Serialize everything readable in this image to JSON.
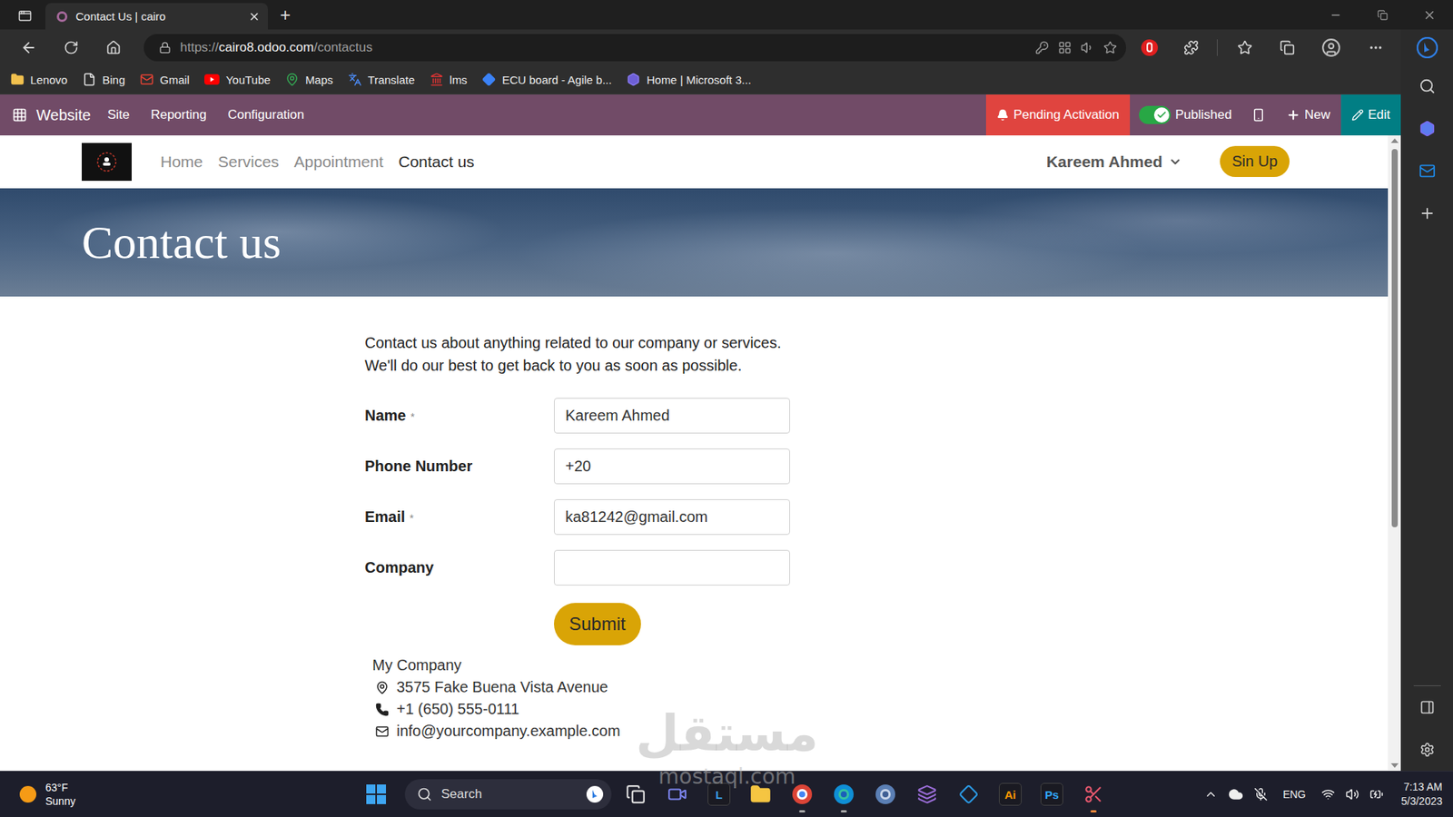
{
  "browser": {
    "tabs": [
      {
        "label": "Contact Us | cairo",
        "selected": true
      }
    ],
    "new_tab": "+",
    "address": {
      "scheme": "https://",
      "host": "cairo8.odoo.com",
      "path": "/contactus"
    },
    "bookmarks": [
      "Lenovo",
      "Bing",
      "Gmail",
      "YouTube",
      "Maps",
      "Translate",
      "lms",
      "ECU board - Agile b...",
      "Home | Microsoft 3..."
    ]
  },
  "odoo_bar": {
    "app": "Website",
    "menu": [
      "Site",
      "Reporting",
      "Configuration"
    ],
    "pending": "Pending Activation",
    "published": {
      "label": "Published",
      "on": true
    },
    "new": "New",
    "edit": "Edit"
  },
  "site_nav": {
    "items": [
      {
        "label": "Home",
        "selected": false
      },
      {
        "label": "Services",
        "selected": false
      },
      {
        "label": "Appointment",
        "selected": false
      },
      {
        "label": "Contact us",
        "selected": true
      }
    ],
    "user": "Kareem Ahmed",
    "signup": "Sin Up"
  },
  "hero": {
    "title": "Contact us"
  },
  "intro": [
    "Contact us about anything related to our company or services.",
    "We'll do our best to get back to you as soon as possible."
  ],
  "form": {
    "required_mark": "*",
    "fields": [
      {
        "label": "Name",
        "required": true,
        "value": "Kareem Ahmed"
      },
      {
        "label": "Phone Number",
        "required": false,
        "value": "+20"
      },
      {
        "label": "Email",
        "required": true,
        "value": "ka81242@gmail.com"
      },
      {
        "label": "Company",
        "required": false,
        "value": ""
      }
    ],
    "submit": "Submit"
  },
  "company": {
    "name": "My Company",
    "address": "3575 Fake Buena Vista Avenue",
    "phone": "+1 (650) 555-0111",
    "email": "info@yourcompany.example.com"
  },
  "watermark": {
    "arabic": "مستقل",
    "latin": "mostaql.com"
  },
  "taskbar": {
    "weather": {
      "temp": "63°F",
      "condition": "Sunny"
    },
    "search": "Search",
    "apps": [
      {
        "kind": "icon",
        "open": false
      },
      {
        "kind": "icon",
        "open": false
      },
      {
        "kind": "letter",
        "label": "L",
        "color": "#3aa0ea",
        "open": false
      },
      {
        "kind": "icon",
        "open": false
      },
      {
        "kind": "icon",
        "open": true
      },
      {
        "kind": "icon",
        "open": true
      },
      {
        "kind": "icon",
        "open": false
      },
      {
        "kind": "icon",
        "open": false
      },
      {
        "kind": "icon",
        "open": false
      },
      {
        "kind": "letter",
        "label": "Ai",
        "color": "#ff9a00",
        "open": false
      },
      {
        "kind": "letter",
        "label": "Ps",
        "color": "#31a8ff",
        "open": false
      },
      {
        "kind": "icon",
        "open": true
      }
    ],
    "lang": "ENG",
    "time": "7:13 AM",
    "date": "5/3/2023"
  }
}
